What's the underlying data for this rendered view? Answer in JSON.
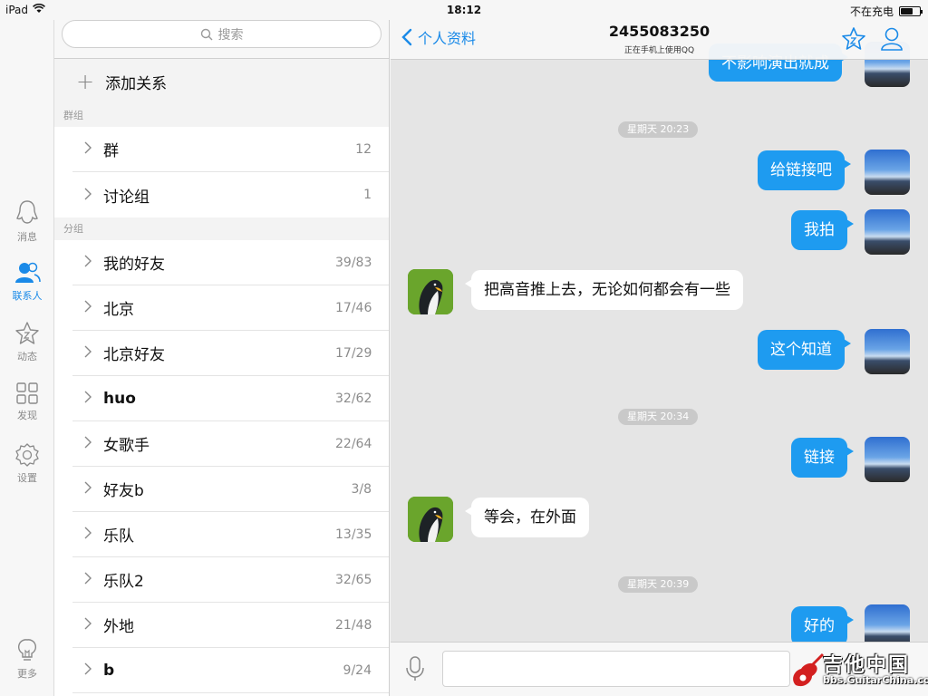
{
  "status_bar": {
    "device": "iPad",
    "time": "18:12",
    "charge_status": "不在充电",
    "battery_level_percent": 65
  },
  "tab_bar": {
    "items": [
      {
        "label": "消息",
        "icon": "message-penguin-icon",
        "active": false
      },
      {
        "label": "联系人",
        "icon": "contacts-icon",
        "active": true
      },
      {
        "label": "动态",
        "icon": "star-icon",
        "active": false
      },
      {
        "label": "发现",
        "icon": "grid-icon",
        "active": false
      },
      {
        "label": "设置",
        "icon": "gear-icon",
        "active": false
      },
      {
        "label": "更多",
        "icon": "lightbulb-icon",
        "active": false
      }
    ]
  },
  "contacts": {
    "search_placeholder": "搜索",
    "add_label": "添加关系",
    "groups_section": "群组",
    "groups": [
      {
        "name": "群",
        "count": "12"
      },
      {
        "name": "讨论组",
        "count": "1"
      }
    ],
    "categories_section": "分组",
    "categories": [
      {
        "name": "我的好友",
        "count": "39/83"
      },
      {
        "name": "北京",
        "count": "17/46"
      },
      {
        "name": "北京好友",
        "count": "17/29"
      },
      {
        "name": "huo",
        "count": "32/62"
      },
      {
        "name": "女歌手",
        "count": "22/64"
      },
      {
        "name": "好友b",
        "count": "3/8"
      },
      {
        "name": "乐队",
        "count": "13/35"
      },
      {
        "name": "乐队2",
        "count": "32/65"
      },
      {
        "name": "外地",
        "count": "21/48"
      },
      {
        "name": "b",
        "count": "9/24"
      }
    ]
  },
  "chat": {
    "back_label": "个人资料",
    "title": "2455083250",
    "subtitle": "正在手机上使用QQ",
    "messages": [
      {
        "kind": "out",
        "text": "不影响演出就成"
      },
      {
        "kind": "time",
        "text": "星期天 20:23"
      },
      {
        "kind": "out",
        "text": "给链接吧"
      },
      {
        "kind": "out",
        "text": "我拍"
      },
      {
        "kind": "in",
        "text": "把高音推上去，无论如何都会有一些"
      },
      {
        "kind": "out",
        "text": "这个知道"
      },
      {
        "kind": "time",
        "text": "星期天 20:34"
      },
      {
        "kind": "out",
        "text": "链接"
      },
      {
        "kind": "in",
        "text": "等会，在外面"
      },
      {
        "kind": "time",
        "text": "星期天 20:39"
      },
      {
        "kind": "out",
        "text": "好的"
      }
    ]
  },
  "watermark": {
    "title": "吉他中国",
    "url": "bbs.GuitarChina.com"
  },
  "colors": {
    "accent": "#1a8ae8",
    "bubble_out": "#1e9bf0",
    "chat_bg": "#e5e5e5"
  }
}
